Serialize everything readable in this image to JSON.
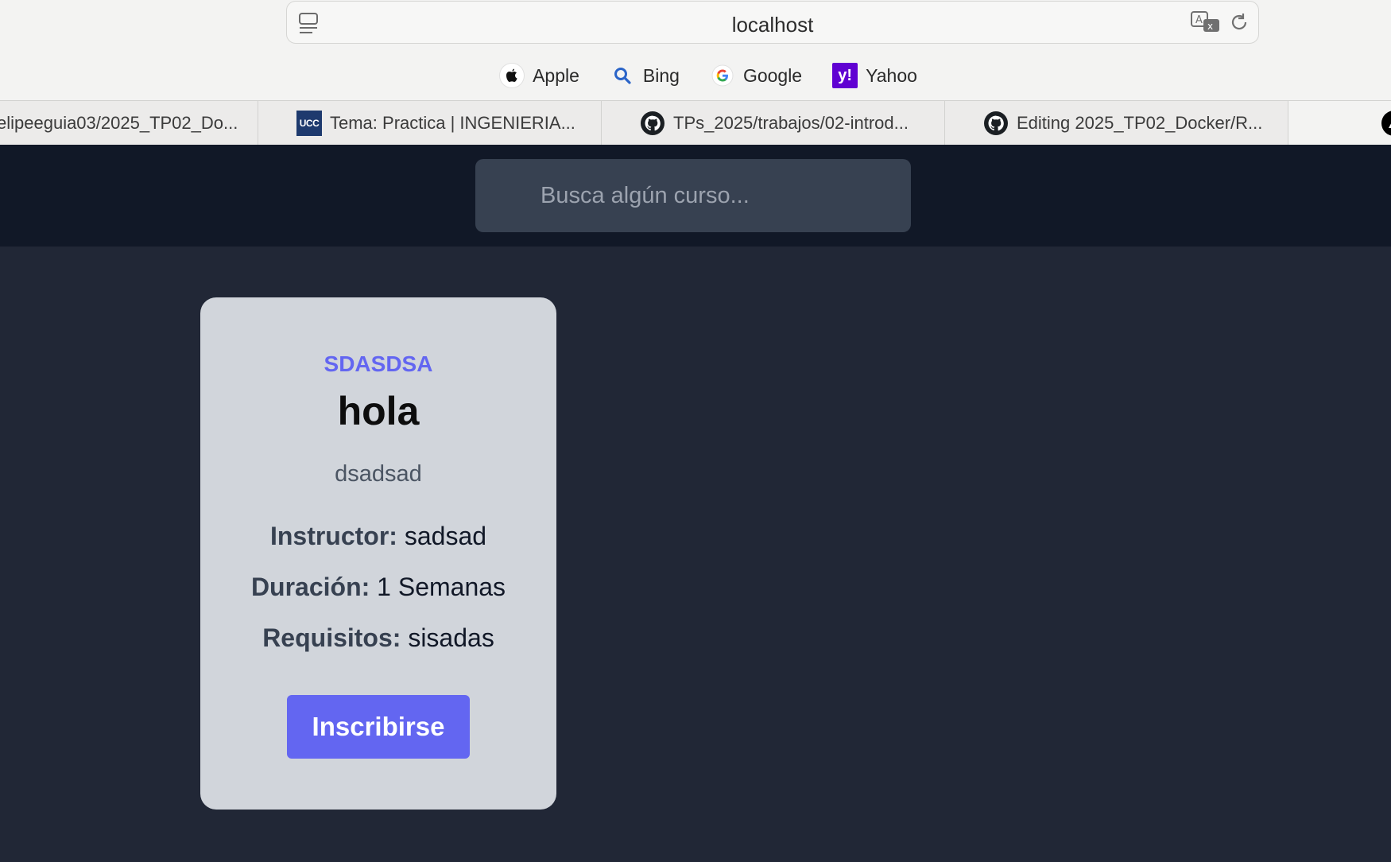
{
  "browser": {
    "url": "localhost",
    "favorites": [
      {
        "label": "Apple",
        "icon": "apple-icon"
      },
      {
        "label": "Bing",
        "icon": "search-icon"
      },
      {
        "label": "Google",
        "icon": "google-icon"
      },
      {
        "label": "Yahoo",
        "icon": "yahoo-icon",
        "icon_text": "y!"
      }
    ],
    "tabs": [
      {
        "label": "elipeeguia03/2025_TP02_Do...",
        "icon": "none"
      },
      {
        "label": "Tema: Practica | INGENIERIA...",
        "icon": "ucc-icon",
        "icon_text": "UCC"
      },
      {
        "label": "TPs_2025/trabajos/02-introd...",
        "icon": "github-icon"
      },
      {
        "label": "Editing 2025_TP02_Docker/R...",
        "icon": "github-icon"
      }
    ]
  },
  "page": {
    "search": {
      "placeholder": "Busca algún curso...",
      "value": ""
    },
    "course": {
      "category": "SDASDSA",
      "title": "hola",
      "description": "dsadsad",
      "instructor_label": "Instructor:",
      "instructor": "sadsad",
      "duration_label": "Duración:",
      "duration": "1 Semanas",
      "requirements_label": "Requisitos:",
      "requirements": "sisadas",
      "enroll_label": "Inscribirse"
    },
    "colors": {
      "nav_bg": "#111827",
      "page_bg": "#212736",
      "card_bg": "#d1d5db",
      "accent": "#6366f1"
    }
  }
}
